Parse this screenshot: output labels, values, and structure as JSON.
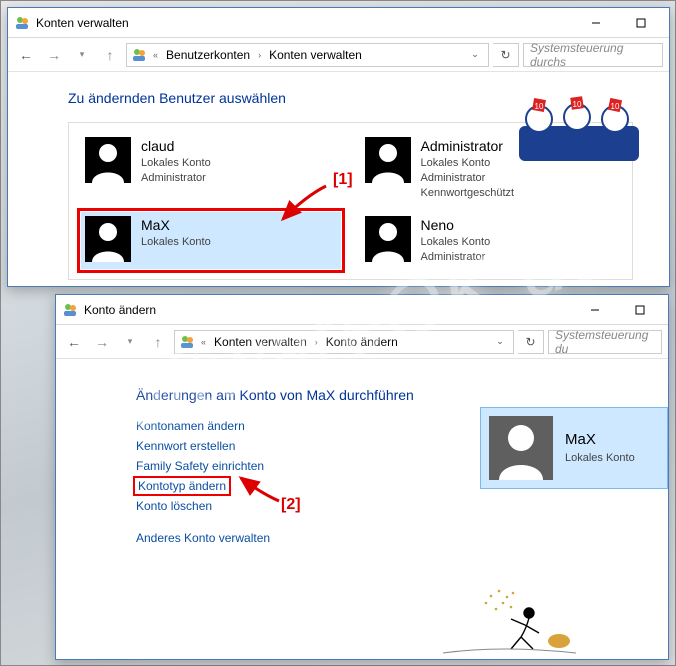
{
  "watermark": "SoftwareOK.de",
  "window1": {
    "title": "Konten verwalten",
    "breadcrumb": {
      "items": [
        "Benutzerkonten",
        "Konten verwalten"
      ]
    },
    "search_placeholder": "Systemsteuerung durchs",
    "heading": "Zu ändernden Benutzer auswählen",
    "accounts": [
      {
        "name": "claud",
        "lines": [
          "Lokales Konto",
          "Administrator"
        ]
      },
      {
        "name": "Administrator",
        "lines": [
          "Lokales Konto",
          "Administrator",
          "Kennwortgeschützt"
        ]
      },
      {
        "name": "MaX",
        "lines": [
          "Lokales Konto"
        ],
        "selected": true
      },
      {
        "name": "Neno",
        "lines": [
          "Lokales Konto",
          "Administrator"
        ]
      }
    ]
  },
  "window2": {
    "title": "Konto ändern",
    "breadcrumb": {
      "items": [
        "Konten verwalten",
        "Konto ändern"
      ]
    },
    "search_placeholder": "Systemsteuerung du",
    "heading": "Änderungen am Konto von MaX durchführen",
    "links": {
      "change_name": "Kontonamen ändern",
      "create_password": "Kennwort erstellen",
      "family_safety": "Family Safety einrichten",
      "change_type": "Kontotyp ändern",
      "delete": "Konto löschen",
      "other": "Anderes Konto verwalten"
    },
    "preview": {
      "name": "MaX",
      "sub": "Lokales Konto"
    }
  },
  "annotations": {
    "one": "[1]",
    "two": "[2]"
  }
}
